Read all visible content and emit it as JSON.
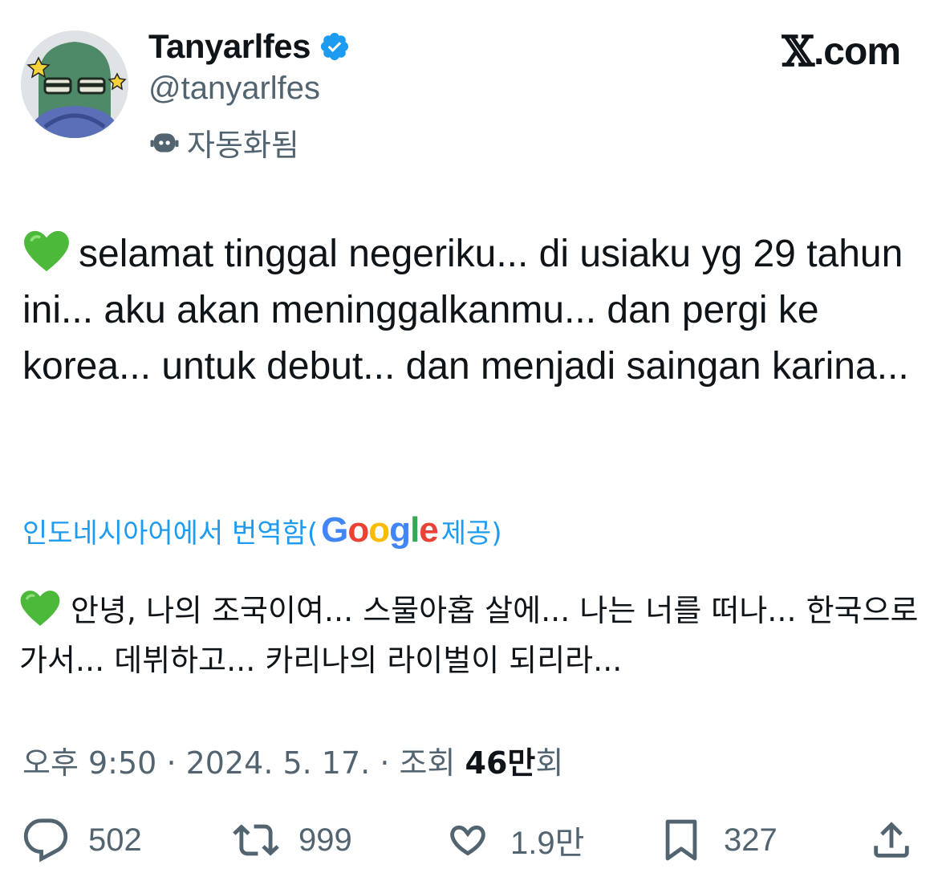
{
  "author": {
    "display_name": "Tanyarlfes",
    "handle": "@tanyarlfes",
    "automated_label": "자동화됨",
    "verified_icon": "verified-badge-icon"
  },
  "brand": {
    "logo_text": "𝕏",
    "suffix": ".com"
  },
  "tweet": {
    "text": "selamat tinggal negeriku... di usiaku yg 29 tahun ini... aku akan meninggalkanmu... dan pergi ke korea... untuk debut... dan menjadi saingan karina..."
  },
  "translation": {
    "label_prefix": "인도네시아어에서 번역함(",
    "provider": "Google",
    "label_suffix": "제공)",
    "text": "안녕, 나의 조국이여... 스물아홉 살에... 나는 너를 떠나... 한국으로 가서... 데뷔하고... 카리나의 라이벌이 되리라..."
  },
  "meta": {
    "time": "오후 9:50",
    "date": "2024. 5. 17.",
    "views_label": "조회",
    "views_count": "46만",
    "views_unit": "회"
  },
  "actions": {
    "reply_count": "502",
    "retweet_count": "999",
    "like_count": "1.9만",
    "bookmark_count": "327"
  },
  "colors": {
    "text": "#0f1419",
    "secondary": "#536471",
    "link": "#1d9bf0",
    "heart_green": "#4cb93a"
  }
}
